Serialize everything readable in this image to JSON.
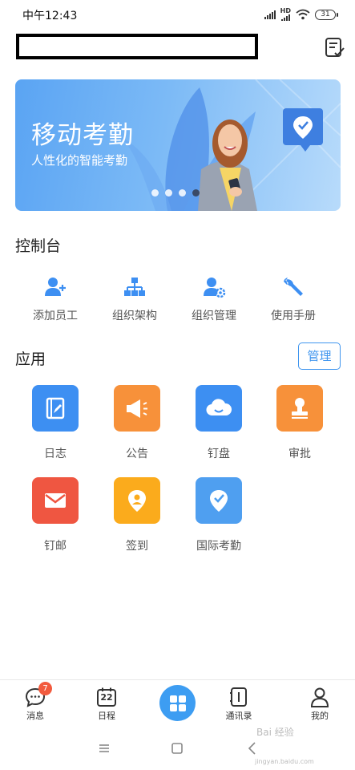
{
  "status_bar": {
    "time": "中午12:43",
    "network": "HD",
    "battery": "31"
  },
  "banner": {
    "title": "移动考勤",
    "subtitle": "人性化的智能考勤",
    "dots": 4,
    "active_dot": 4
  },
  "console": {
    "title": "控制台",
    "items": [
      {
        "label": "添加员工",
        "icon": "add-user-icon"
      },
      {
        "label": "组织架构",
        "icon": "org-chart-icon"
      },
      {
        "label": "组织管理",
        "icon": "user-settings-icon"
      },
      {
        "label": "使用手册",
        "icon": "wrench-icon"
      }
    ]
  },
  "apps": {
    "title": "应用",
    "manage_label": "管理",
    "items": [
      {
        "label": "日志",
        "icon": "log-icon",
        "color": "#3d8ff2"
      },
      {
        "label": "公告",
        "icon": "megaphone-icon",
        "color": "#f7913a"
      },
      {
        "label": "钉盘",
        "icon": "cloud-icon",
        "color": "#3d8ff2"
      },
      {
        "label": "审批",
        "icon": "stamp-icon",
        "color": "#f7913a"
      },
      {
        "label": "钉邮",
        "icon": "mail-icon",
        "color": "#ef5641"
      },
      {
        "label": "签到",
        "icon": "location-pin-icon",
        "color": "#fbab1c"
      },
      {
        "label": "国际考勤",
        "icon": "location-check-icon",
        "color": "#4f9ff0"
      }
    ]
  },
  "tabbar": {
    "items": [
      {
        "label": "消息",
        "icon": "chat-icon",
        "badge": "7"
      },
      {
        "label": "日程",
        "icon": "calendar-icon",
        "calendar_day": "22"
      },
      {
        "label": "",
        "icon": "grid-icon"
      },
      {
        "label": "通讯录",
        "icon": "contacts-icon"
      },
      {
        "label": "我的",
        "icon": "profile-icon"
      }
    ],
    "accent": "#3d9df2"
  },
  "watermark": {
    "text": "Bai 经验",
    "url_text": "jingyan.baidu.com"
  }
}
